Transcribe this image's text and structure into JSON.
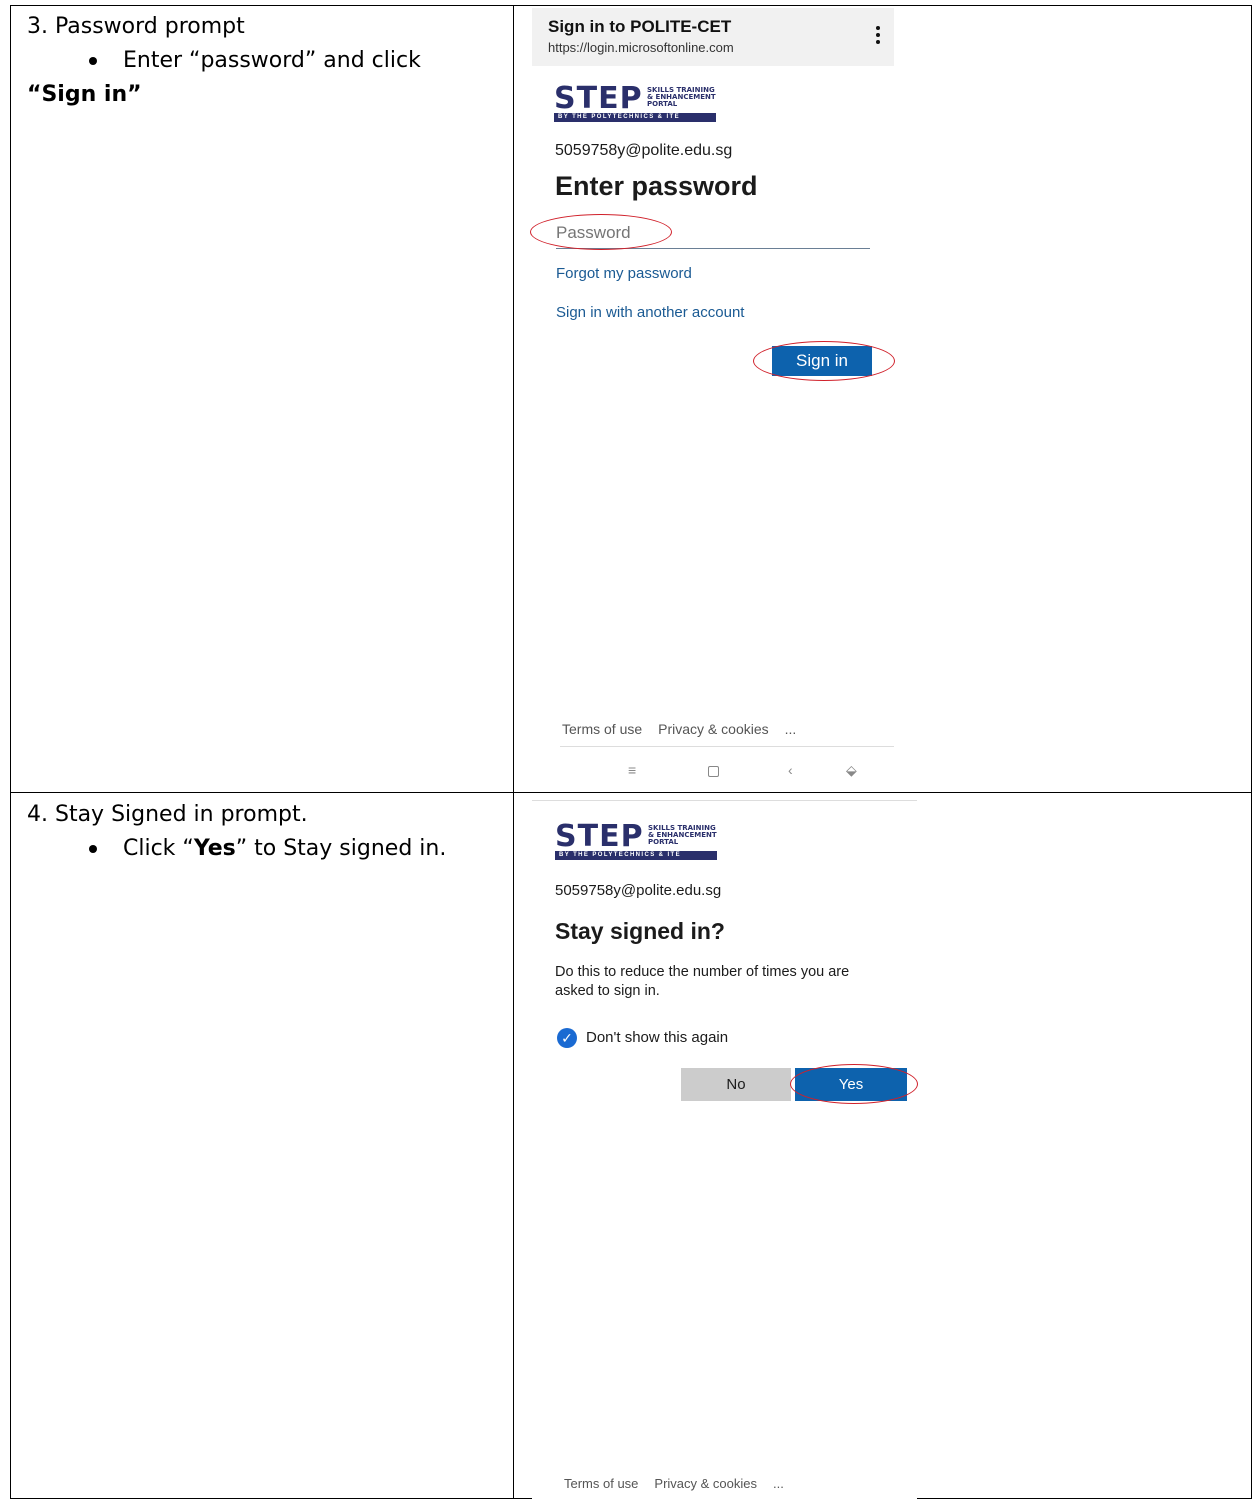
{
  "steps": [
    {
      "title": "3. Password prompt",
      "bullet_pre": "Enter “password” and click",
      "bullet_bold": "“Sign in”"
    },
    {
      "title": "4. Stay Signed in prompt.",
      "bullet_pre": "Click “",
      "bullet_bold": "Yes",
      "bullet_post": "” to Stay signed in."
    }
  ],
  "logo": {
    "word": "STEP",
    "side_lines": [
      "SKILLS TRAINING",
      "& ENHANCEMENT",
      "PORTAL"
    ],
    "bar_text": "BY THE POLYTECHNICS & ITE",
    "color": "#2a2f6b"
  },
  "screen_password": {
    "browser_title": "Sign in to POLITE-CET",
    "browser_url": "https://login.microsoftonline.com",
    "email": "5059758y@polite.edu.sg",
    "heading": "Enter password",
    "password_placeholder": "Password",
    "password_value": "",
    "forgot_link": "Forgot my password",
    "another_account_link": "Sign in with another account",
    "sign_in_label": "Sign in",
    "footer": [
      "Terms of use",
      "Privacy & cookies",
      "..."
    ],
    "nav_icons": [
      "menu-icon",
      "home-icon",
      "back-icon",
      "download-icon"
    ]
  },
  "screen_stay": {
    "email": "5059758y@polite.edu.sg",
    "heading": "Stay signed in?",
    "description": "Do this to reduce the number of times you are asked to sign in.",
    "checkbox_label": "Don't show this again",
    "checkbox_checked": true,
    "no_label": "No",
    "yes_label": "Yes",
    "footer": [
      "Terms of use",
      "Privacy & cookies",
      "..."
    ]
  },
  "colors": {
    "accent_blue": "#0d62ad",
    "link_blue": "#1a5a93",
    "highlight_ring": "#d0202a",
    "checkbox_blue": "#1a6ad2"
  }
}
